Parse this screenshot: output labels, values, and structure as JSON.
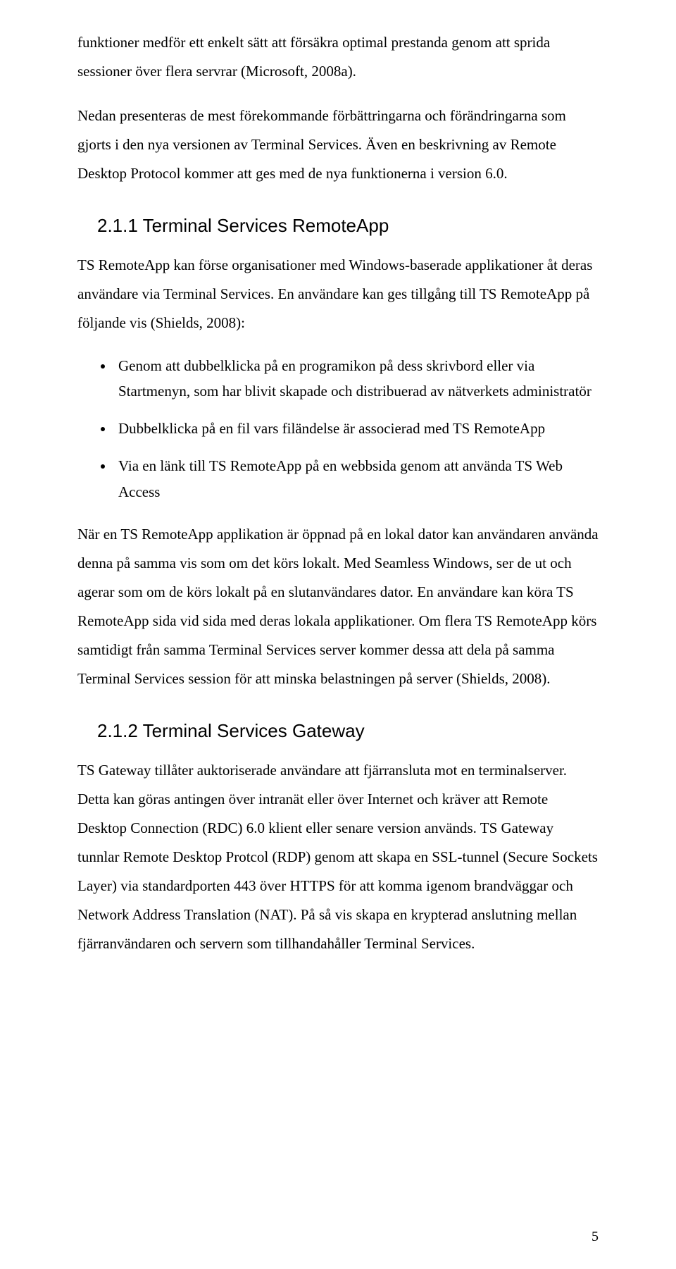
{
  "paragraphs": {
    "intro1": "funktioner medför ett enkelt sätt att försäkra optimal prestanda genom att sprida sessioner över flera servrar (Microsoft, 2008a).",
    "intro2": "Nedan presenteras de mest förekommande förbättringarna och förändringarna som gjorts i den nya versionen av Terminal Services. Även en beskrivning av Remote Desktop Protocol kommer att ges med de nya funktionerna i version 6.0.",
    "remoteapp_body": "TS RemoteApp kan förse organisationer med Windows-baserade applikationer åt deras användare via Terminal Services. En användare kan ges tillgång till TS RemoteApp på följande vis (Shields, 2008):",
    "remoteapp_after": "När en TS RemoteApp applikation är öppnad på en lokal dator kan användaren använda denna på samma vis som om det körs lokalt. Med Seamless Windows, ser de ut och agerar som om de körs lokalt på en slutanvändares dator. En användare kan köra TS RemoteApp sida vid sida med deras lokala applikationer. Om flera TS RemoteApp körs samtidigt från samma Terminal Services server kommer dessa att dela på samma Terminal Services session för att minska belastningen på server (Shields, 2008).",
    "gateway_body": "TS Gateway tillåter auktoriserade användare att fjärransluta mot en terminalserver. Detta kan göras antingen över intranät eller över Internet och kräver att Remote Desktop Connection (RDC) 6.0 klient eller senare version används. TS Gateway tunnlar Remote Desktop Protcol (RDP) genom att skapa en SSL-tunnel (Secure Sockets Layer) via standardporten 443 över HTTPS för att komma igenom brandväggar och Network Address Translation (NAT). På så vis skapa en krypterad anslutning mellan fjärranvändaren och servern som tillhandahåller Terminal Services."
  },
  "headings": {
    "remoteapp": "2.1.1 Terminal Services RemoteApp",
    "gateway": "2.1.2 Terminal Services Gateway"
  },
  "bullets": [
    "Genom att dubbelklicka på en programikon på dess skrivbord eller via Startmenyn, som har blivit skapade och distribuerad av nätverkets administratör",
    "Dubbelklicka på en fil vars filändelse är associerad med TS RemoteApp",
    "Via en länk till TS RemoteApp på en webbsida genom att använda TS Web Access"
  ],
  "page_number": "5"
}
